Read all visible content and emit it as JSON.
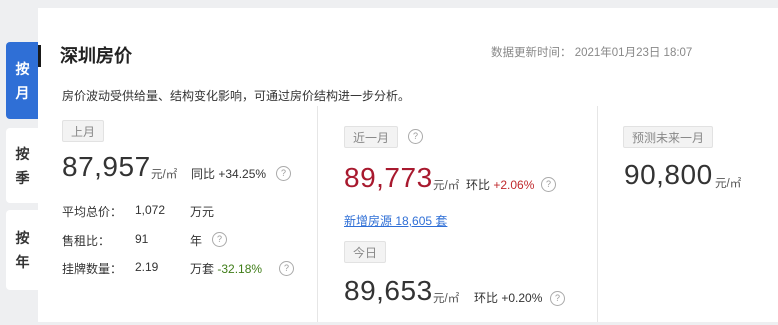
{
  "side_tabs": [
    {
      "chars": [
        "按",
        "月"
      ],
      "active": true
    },
    {
      "chars": [
        "按",
        "季"
      ],
      "active": false
    },
    {
      "chars": [
        "按",
        "年"
      ],
      "active": false
    }
  ],
  "header": {
    "title": "深圳房价",
    "update_time": "数据更新时间：  2021年01月23日 18:07",
    "description": "房价波动受供给量、结构变化影响，可通过房价结构进一步分析。"
  },
  "last_month": {
    "label": "上月",
    "price": "87,957",
    "price_unit": "元/㎡",
    "yoy_label": "同比",
    "yoy_value": "+34.25%",
    "avg_total_label": "平均总价：",
    "avg_total_value": "1,072",
    "avg_total_unit": "万元",
    "rent_ratio_label": "售租比：",
    "rent_ratio_value": "91",
    "rent_ratio_unit": "年",
    "listing_label": "挂牌数量：",
    "listing_value": "2.19",
    "listing_unit": "万套",
    "listing_change": "-32.18%"
  },
  "recent_month": {
    "label": "近一月",
    "price": "89,773",
    "price_unit": "元/㎡",
    "mom_label": "环比",
    "mom_value": "+2.06%",
    "new_listings_link": "新增房源 18,605 套"
  },
  "today": {
    "label": "今日",
    "price": "89,653",
    "price_unit": "元/㎡",
    "mom_label": "环比",
    "mom_value": "+0.20%"
  },
  "forecast": {
    "label": "预测未来一月",
    "price": "90,800",
    "price_unit": "元/㎡"
  },
  "help_glyph": "?",
  "colors": {
    "accent_blue": "#2f6fd6",
    "price_red": "#a8192e",
    "change_red": "#c0292c",
    "change_green": "#3f7d18"
  }
}
